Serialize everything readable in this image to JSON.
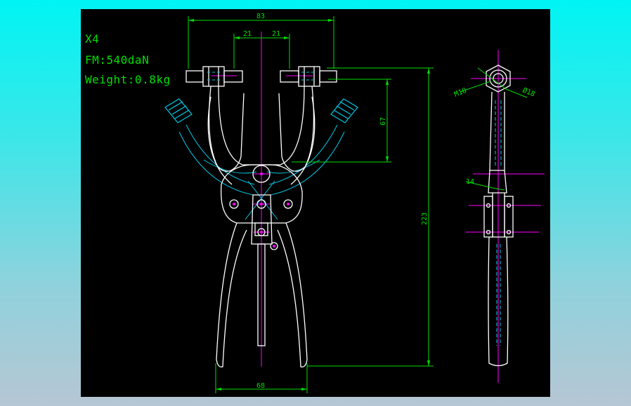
{
  "notes": {
    "model": "X4",
    "force": "FM:540daN",
    "weight": "Weight:0.8kg"
  },
  "dimensions": {
    "top_width": "83",
    "jaw_left": "21",
    "jaw_right": "21",
    "jaw_height": "67",
    "overall_height": "223",
    "handle_width": "68",
    "thread": "M10",
    "diameter": "Ø18",
    "thickness": "14"
  },
  "colors": {
    "background": "#000000",
    "outline": "#ffffff",
    "dimension": "#00e000",
    "centerline": "#ff00ff",
    "secondary": "#00c8e6"
  }
}
